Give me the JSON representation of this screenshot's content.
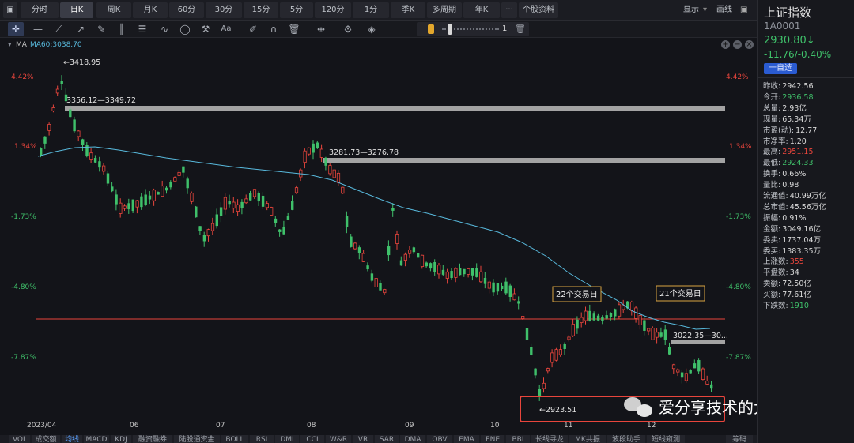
{
  "periods": [
    {
      "label": "分时",
      "active": false
    },
    {
      "label": "日K",
      "active": true
    },
    {
      "label": "周K",
      "active": false
    },
    {
      "label": "月K",
      "active": false
    },
    {
      "label": "60分",
      "active": false
    },
    {
      "label": "30分",
      "active": false
    },
    {
      "label": "15分",
      "active": false
    },
    {
      "label": "5分",
      "active": false
    },
    {
      "label": "120分",
      "active": false
    },
    {
      "label": "1分",
      "active": false
    },
    {
      "label": "季K",
      "active": false
    },
    {
      "label": "多周期",
      "active": false
    },
    {
      "label": "年K",
      "active": false
    },
    {
      "label": "···",
      "active": false
    },
    {
      "label": "个股资料",
      "active": false
    }
  ],
  "topbar_right": {
    "display": "显示",
    "drawline": "画线"
  },
  "zoom_value": "1",
  "ma_label": "MA",
  "ma60": "MA60:3038.70",
  "colors": {
    "up": "#e8453c",
    "down": "#3fc06a",
    "ma": "#58b9dc",
    "hline": "#e8453c",
    "box_border": "#d9a441"
  },
  "chart": {
    "pct_labels": [
      "4.42%",
      "1.34%",
      "-1.73%",
      "-4.80%",
      "-7.87%"
    ],
    "x_labels": [
      "2023/04",
      "06",
      "07",
      "08",
      "09",
      "10",
      "11",
      "12"
    ],
    "annotations": {
      "high_label": "←3418.95",
      "low_label": "←2923.51",
      "range1": "3356.12—3349.72",
      "range2": "3281.73—3276.78",
      "range3": "3022.35—30...",
      "box1": "22个交易日",
      "box2": "21个交易日"
    },
    "watermark": "爱分享技术的大白"
  },
  "bottom_tabs": [
    "VOL",
    "成交额",
    "均线",
    "MACD",
    "KDJ",
    "融资融券",
    "陆股通资金",
    "BOLL",
    "RSI",
    "DMI",
    "CCI",
    "W&R",
    "VR",
    "SAR",
    "DMA",
    "OBV",
    "EMA",
    "ENE",
    "BBI",
    "长线寻龙",
    "MK共振",
    "波段助手",
    "短线窥测"
  ],
  "bottom_right": "筹码",
  "active_tab": "均线",
  "panel": {
    "name": "上证指数",
    "code": "1A0001",
    "price": "2930.80↓",
    "change": "-11.76/-0.40%",
    "watch": "一自选",
    "rows": [
      {
        "k": "昨收:",
        "v": "2942.56",
        "c": "white"
      },
      {
        "k": "今开:",
        "v": "2936.58",
        "c": "green"
      },
      {
        "k": "总量:",
        "v": "2.93亿",
        "c": "white"
      },
      {
        "k": "现量:",
        "v": "65.34万",
        "c": "white"
      },
      {
        "k": "市盈(动):",
        "v": "12.77",
        "c": "white"
      },
      {
        "k": "市净率:",
        "v": "1.20",
        "c": "white"
      },
      {
        "k": "最高:",
        "v": "2951.15",
        "c": "red"
      },
      {
        "k": "最低:",
        "v": "2924.33",
        "c": "green"
      },
      {
        "k": "换手:",
        "v": "0.66%",
        "c": "white"
      },
      {
        "k": "量比:",
        "v": "0.98",
        "c": "white"
      },
      {
        "k": "流通值:",
        "v": "40.99万亿",
        "c": "white"
      },
      {
        "k": "总市值:",
        "v": "45.56万亿",
        "c": "white"
      },
      {
        "k": "振幅:",
        "v": "0.91%",
        "c": "white"
      },
      {
        "k": "金额:",
        "v": "3049.16亿",
        "c": "white"
      },
      {
        "k": "委卖:",
        "v": "1737.04万",
        "c": "white"
      },
      {
        "k": "委买:",
        "v": "1383.35万",
        "c": "white"
      },
      {
        "k": "上涨数:",
        "v": "355",
        "c": "red"
      },
      {
        "k": "平盘数:",
        "v": "34",
        "c": "white"
      },
      {
        "k": "卖额:",
        "v": "72.50亿",
        "c": "white"
      },
      {
        "k": "买额:",
        "v": "77.61亿",
        "c": "white"
      },
      {
        "k": "下跌数:",
        "v": "1910",
        "c": "green"
      }
    ]
  }
}
